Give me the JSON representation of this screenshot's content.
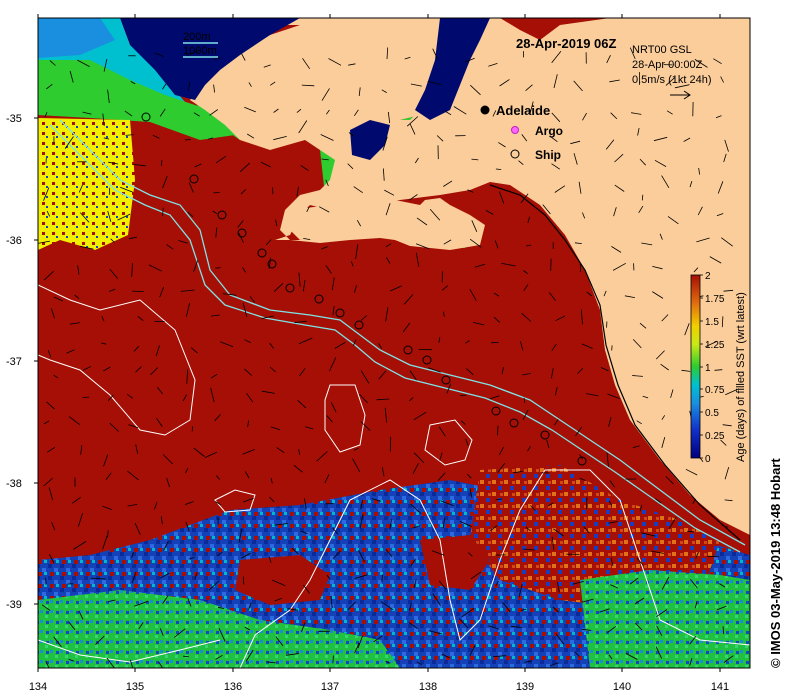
{
  "map": {
    "title": "28-Apr-2019 06Z",
    "place_label": "Adelaide",
    "legend_argo": "Argo",
    "legend_ship": "Ship",
    "depth_legend": [
      "200m",
      "1000m"
    ],
    "current_info": [
      "NRT00 GSL",
      "28-Apr 00:00Z",
      "0.5m/s (1kt 24h)"
    ],
    "x_ticks": [
      "134",
      "135",
      "136",
      "137",
      "138",
      "139",
      "140",
      "141"
    ],
    "y_ticks": [
      "-35",
      "-36",
      "-37",
      "-38",
      "-39"
    ],
    "colorbar_ticks": [
      "2",
      "1.75",
      "1.5",
      "1.25",
      "1",
      "0.75",
      "0.5",
      "0.25",
      "0"
    ],
    "colorbar_label": "Age (days) of filled SST (wrt latest)",
    "credit": "© IMOS 03-May-2019 13:48 Hobart",
    "colors": {
      "land": "#fbcd9b",
      "ocean_fill": "#a50f05",
      "green": "#2fcc2f",
      "cyan": "#00c0d0",
      "yellow": "#f0f000",
      "blue": "#1030c0",
      "orange": "#e06a10",
      "shelf_lines": "#7fe3e6",
      "contour_white": "#ffffff"
    }
  }
}
